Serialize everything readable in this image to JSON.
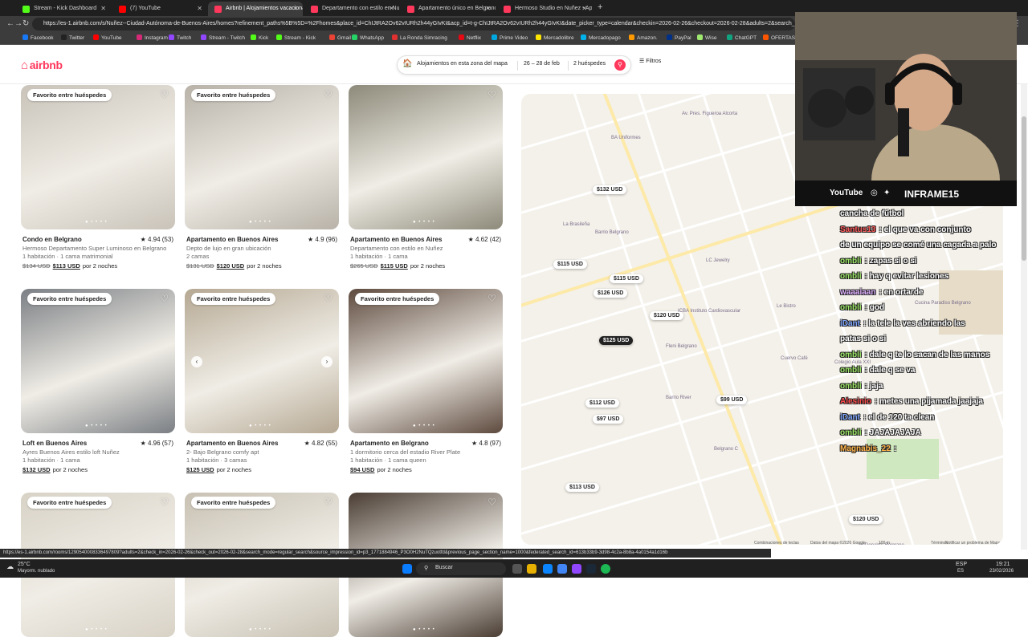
{
  "browser": {
    "tabs": [
      {
        "label": "Stream - Kick Dashboard",
        "color": "#53fc18"
      },
      {
        "label": "(7) YouTube",
        "color": "#ff0000"
      },
      {
        "label": "Airbnb | Alojamientos vacacionales",
        "color": "#ff385c"
      },
      {
        "label": "Departamento con estilo en Nuñez",
        "color": "#ff385c"
      },
      {
        "label": "Apartamento único en Belgrano",
        "color": "#ff385c"
      },
      {
        "label": "Hermoso Studio en Nuñez - Apart...",
        "color": "#ff385c"
      }
    ],
    "new_tab": "+",
    "url": "https://es-1.airbnb.com/s/Nuñez--Ciudad-Autónoma-de-Buenos-Aires/homes?refinement_paths%5B%5D=%2Fhomes&place_id=ChIJtRA2Ov62vIURh2h44yGIvKI&acp_id=t-g-ChIJtRA2Ov62vIURh2h44yGIvKI&date_picker_type=calendar&checkin=2026-02-26&checkout=2026-02-28&adults=2&search_type",
    "bookmarks": [
      {
        "label": "Facebook",
        "color": "#1877f2"
      },
      {
        "label": "Twitter",
        "color": "#222222"
      },
      {
        "label": "YouTube",
        "color": "#ff0000"
      },
      {
        "label": "Instagram",
        "color": "#d62976"
      },
      {
        "label": "Twitch",
        "color": "#9146ff"
      },
      {
        "label": "Stream - Twitch",
        "color": "#9146ff"
      },
      {
        "label": "Kick",
        "color": "#53fc18"
      },
      {
        "label": "Stream - Kick",
        "color": "#53fc18"
      },
      {
        "label": "Gmail",
        "color": "#ea4335"
      },
      {
        "label": "WhatsApp",
        "color": "#25d366"
      },
      {
        "label": "La Ronda Simracing",
        "color": "#e03030"
      },
      {
        "label": "Netflix",
        "color": "#e50914"
      },
      {
        "label": "Prime Video",
        "color": "#00a8e1"
      },
      {
        "label": "Mercadolibre",
        "color": "#ffe600"
      },
      {
        "label": "Mercadopago",
        "color": "#00b1ea"
      },
      {
        "label": "Amazon.",
        "color": "#ff9900"
      },
      {
        "label": "PayPal",
        "color": "#003087"
      },
      {
        "label": "Wise",
        "color": "#9fe870"
      },
      {
        "label": "ChatGPT",
        "color": "#10a37f"
      },
      {
        "label": "OFERTAS RKY",
        "color": "#ff5500"
      }
    ]
  },
  "airbnb": {
    "logo": "airbnb",
    "search": {
      "where": "Alojamientos en esta zona del mapa",
      "dates": "26 – 28 de feb",
      "guests": "2 huéspedes",
      "filters": "Filtros"
    },
    "listings": [
      {
        "badge": "Favorito entre huéspedes",
        "title": "Condo en Belgrano",
        "rating": "★ 4.94 (53)",
        "line2": "Hermoso Departamento Super Luminoso en Belgrano",
        "line3": "1 habitación · 1 cama matrimonial",
        "old_price": "$134 USD",
        "price": "$113 USD",
        "per": "por 2 noches",
        "tone": "#c9c3b9"
      },
      {
        "badge": "Favorito entre huéspedes",
        "title": "Apartamento en Buenos Aires",
        "rating": "★ 4.9 (96)",
        "line2": "Depto de lujo en gran ubicación",
        "line3": "2 camas",
        "old_price": "$131 USD",
        "price": "$120 USD",
        "per": "por 2 noches",
        "tone": "#b8b2a8"
      },
      {
        "badge": "",
        "title": "Apartamento en Buenos Aires",
        "rating": "★ 4.62 (42)",
        "line2": "Departamento con estilo en Nuñez",
        "line3": "1 habitación · 1 cama",
        "old_price": "$265 USD",
        "price": "$115 USD",
        "per": "por 2 noches",
        "tone": "#8d8a7a"
      },
      {
        "badge": "Favorito entre huéspedes",
        "title": "Loft en Buenos Aires",
        "rating": "★ 4.96 (57)",
        "line2": "Ayres Buenos Aires estilo loft Nuñez",
        "line3": "1 habitación · 1 cama",
        "old_price": "",
        "price": "$132 USD",
        "per": "por 2 noches",
        "tone": "#7b7f84"
      },
      {
        "badge": "Favorito entre huéspedes",
        "title": "Apartamento en Buenos Aires",
        "rating": "★ 4.82 (55)",
        "line2": "2- Bajo Belgrano comfy apt",
        "line3": "1 habitación · 3 camas",
        "old_price": "",
        "price": "$125 USD",
        "per": "por 2 noches",
        "tone": "#b5a893"
      },
      {
        "badge": "Favorito entre huéspedes",
        "title": "Apartamento en Belgrano",
        "rating": "★ 4.8 (97)",
        "line2": "1 dormitorio cerca del estadio River Plate",
        "line3": "1 habitación · 1 cama queen",
        "old_price": "",
        "price": "$94 USD",
        "per": "por 2 noches",
        "tone": "#5e4a3e"
      },
      {
        "badge": "Favorito entre huéspedes",
        "title": "",
        "rating": "",
        "line2": "",
        "line3": "",
        "old_price": "",
        "price": "",
        "per": "",
        "tone": "#d8d2c6"
      },
      {
        "badge": "Favorito entre huéspedes",
        "title": "",
        "rating": "",
        "line2": "",
        "line3": "",
        "old_price": "",
        "price": "",
        "per": "",
        "tone": "#c8c1b3"
      },
      {
        "badge": "",
        "title": "",
        "rating": "",
        "line2": "",
        "line3": "",
        "old_price": "",
        "price": "",
        "per": "",
        "tone": "#4a3d33"
      }
    ],
    "map": {
      "pins": [
        "$132 USD",
        "$115 USD",
        "$115 USD",
        "$126 USD",
        "$120 USD",
        "$125 USD",
        "$112 USD",
        "$97 USD",
        "$99 USD",
        "$113 USD",
        "$120 USD"
      ],
      "labels": [
        "Av. Pres. Figueroa Alcorta",
        "BA Uniformes",
        "La Brasileña",
        "Barrio Belgrano",
        "LC Jewelry",
        "ICBA Instituto Cardiovascular",
        "Fleni Belgrano",
        "Cuervo Café",
        "Belgrano C",
        "Barrio River",
        "Le Bistro",
        "Cucina Paradiso Belgrano",
        "Colegio Aula XXI",
        "McDonald's Belgrano",
        "Combinaciones de teclas",
        "Datos del mapa ©2026 Google",
        "100 m",
        "Términos",
        "Notificar un problema de Maps"
      ]
    }
  },
  "stream": {
    "social": {
      "youtube": "YouTube",
      "handle": "INFRAME15"
    },
    "chat": [
      {
        "user": "",
        "text": "cancha de fútbol",
        "color": "#ffffff"
      },
      {
        "user": "Santus13",
        "text": ": el que va con conjunto",
        "color": "#ff5a5a"
      },
      {
        "user": "",
        "text": "de un equipo se comé una cagada a palo",
        "color": "#ffffff"
      },
      {
        "user": "ombli",
        "text": ": zapas si o si",
        "color": "#9be564"
      },
      {
        "user": "ombli",
        "text": ": hay q evitar lesiones",
        "color": "#9be564"
      },
      {
        "user": "waaaiaan",
        "text": ": en ortarde",
        "color": "#e0b0ff"
      },
      {
        "user": "ombli",
        "text": ": god",
        "color": "#9be564"
      },
      {
        "user": "iDant",
        "text": ": la tele la ves abriendo las",
        "color": "#7fa7ff"
      },
      {
        "user": "",
        "text": "patas si o si",
        "color": "#ffffff"
      },
      {
        "user": "ombli",
        "text": ": dale q te lo sacan de las manos",
        "color": "#9be564"
      },
      {
        "user": "ombli",
        "text": ": dale q se va",
        "color": "#9be564"
      },
      {
        "user": "ombli",
        "text": ": jaja",
        "color": "#9be564"
      },
      {
        "user": "Alesinio",
        "text": ": metes una pijamada jaajaja",
        "color": "#ff4a4a"
      },
      {
        "user": "iDant",
        "text": ": el de 120 ta clean",
        "color": "#7fa7ff"
      },
      {
        "user": "ombli",
        "text": ": JAJAJAJAJA",
        "color": "#9be564"
      },
      {
        "user": "Magnabis_22",
        "text": ":",
        "color": "#ffb347"
      }
    ]
  },
  "status_url": "https://es-1.airbnb.com/rooms/1290540008336497809?adults=2&check_in=2026-02-26&check_out=2026-02-28&search_mode=regular_search&source_impression_id=p3_1771884946_P3O0H2NuTQzuotfd&previous_page_section_name=1000&federated_search_id=613b33b9-3d98-4c2a-8b8a-4a0154a1d16b",
  "taskbar": {
    "weather_temp": "25°C",
    "weather_desc": "Mayorm. nublado",
    "search": "Buscar",
    "lang": "ESP",
    "region": "ES",
    "time": "19:21",
    "date": "23/02/2026"
  }
}
